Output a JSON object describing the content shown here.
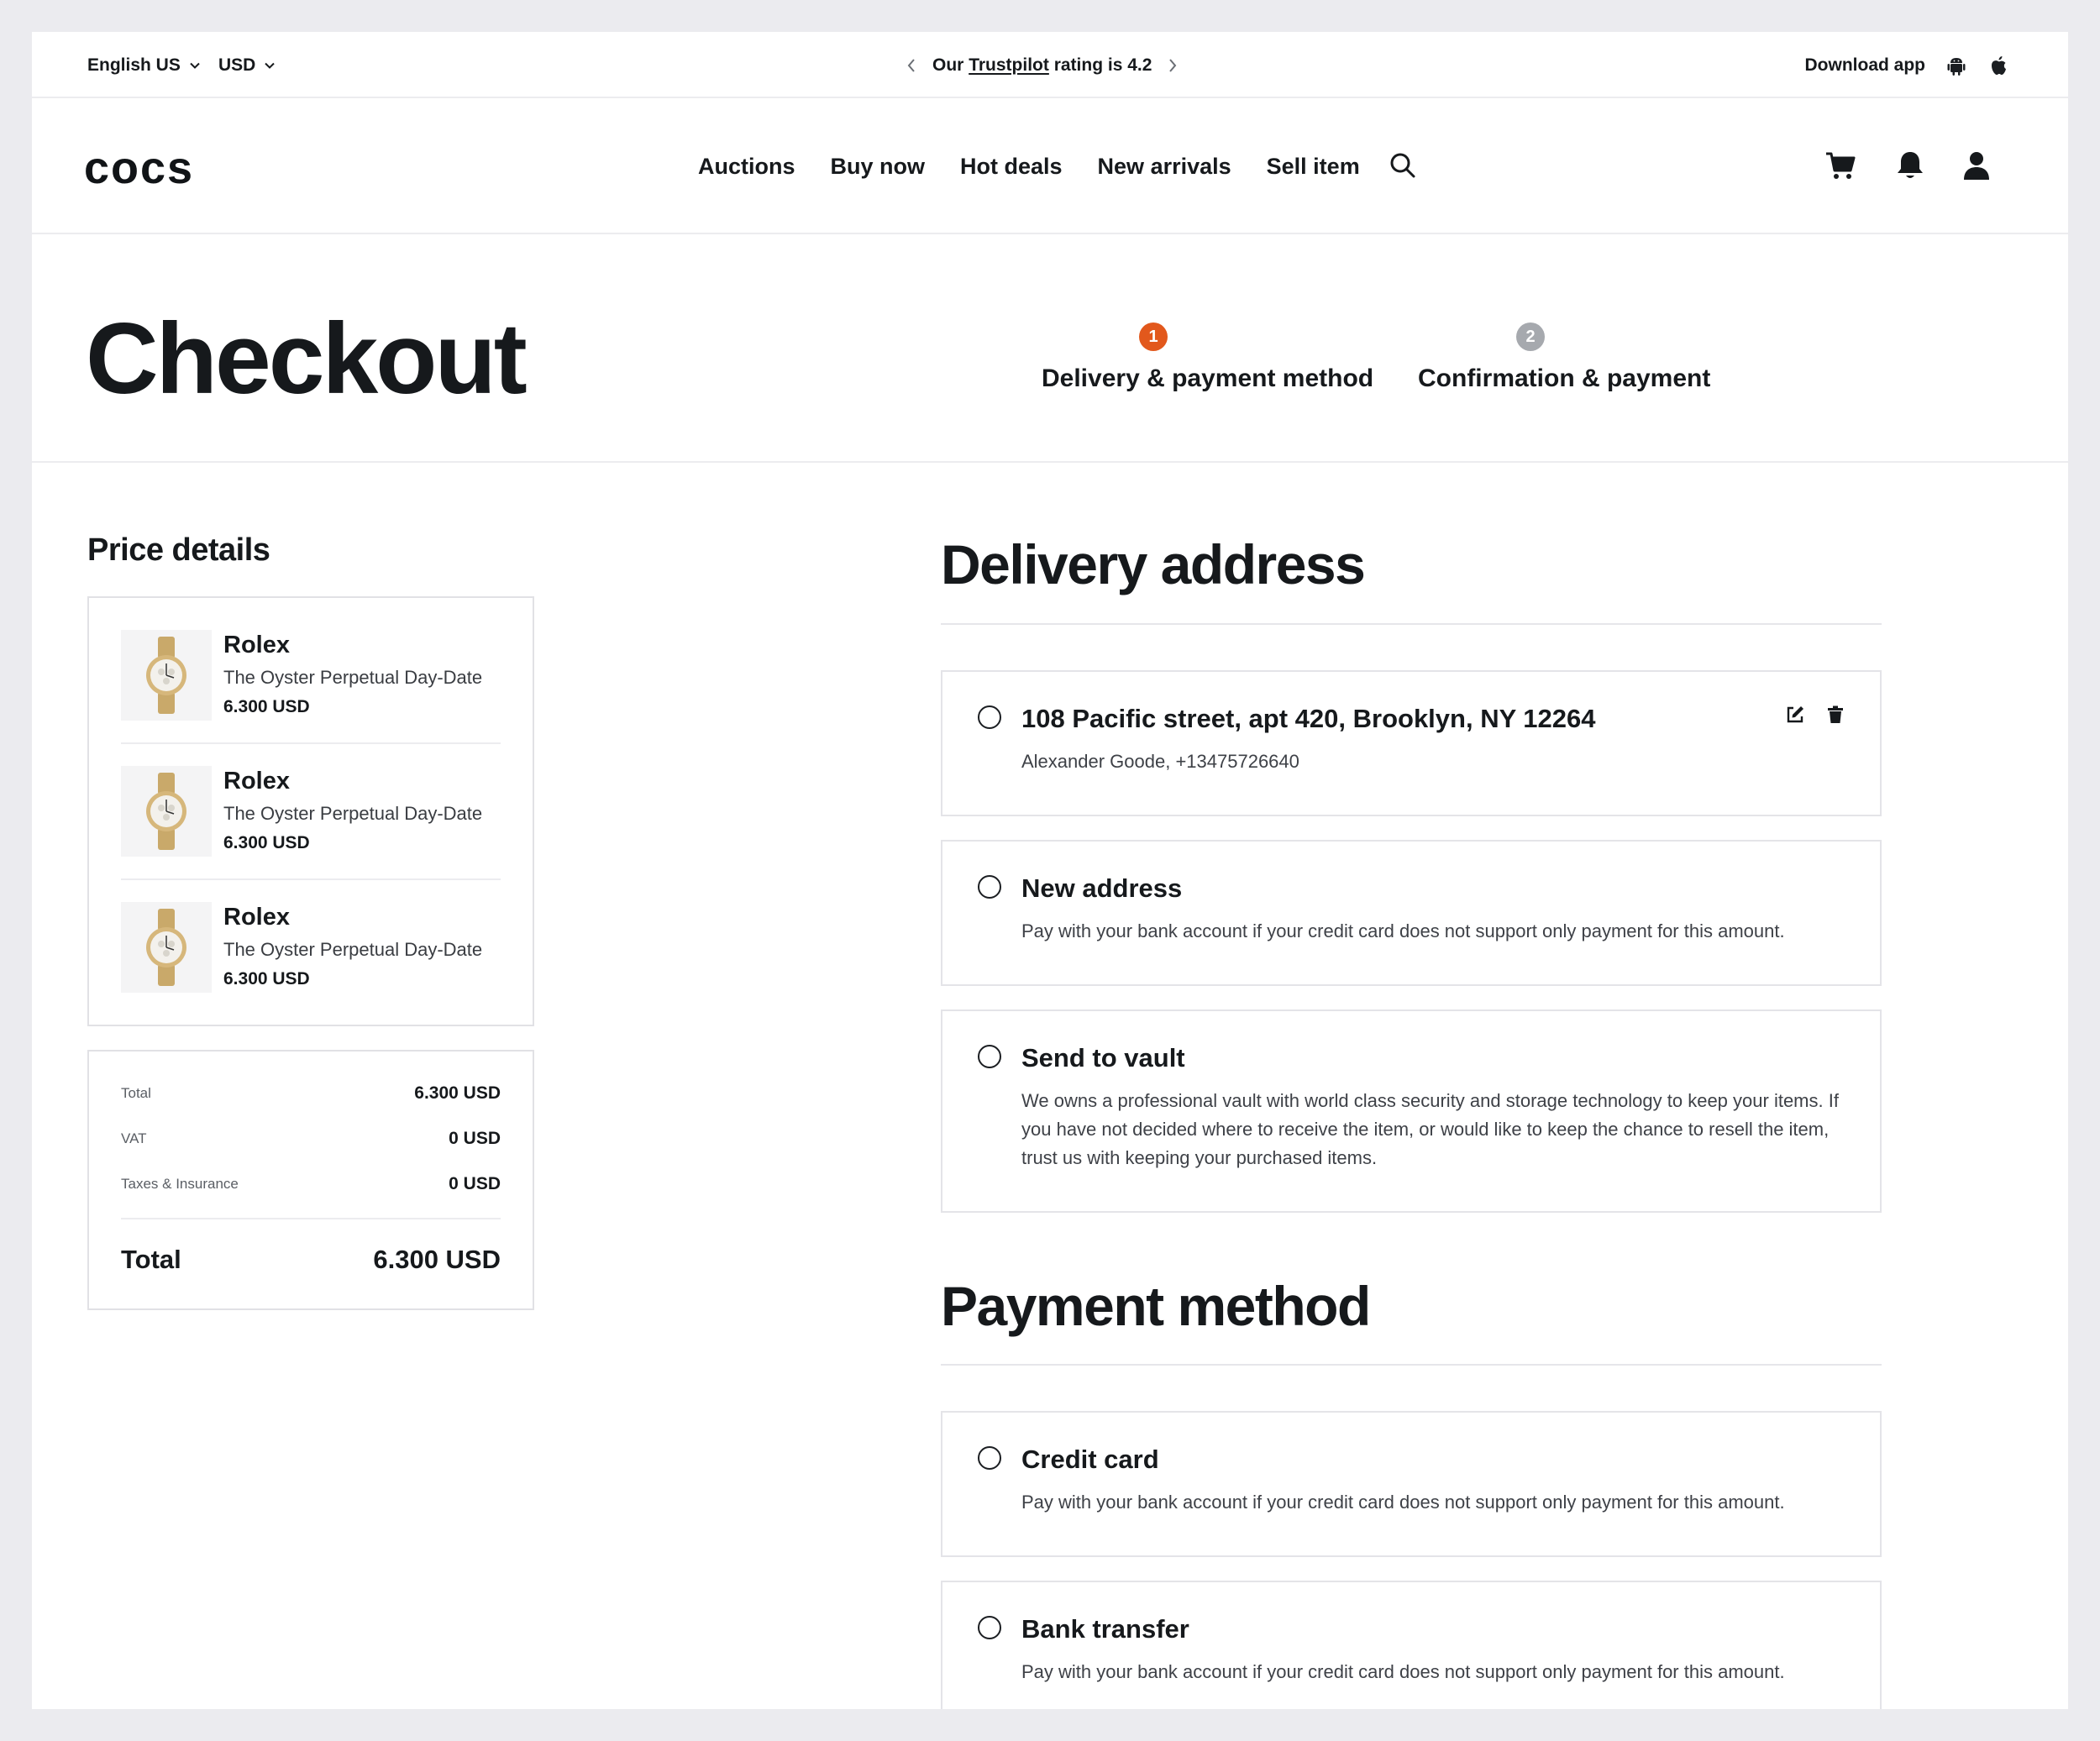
{
  "topbar": {
    "language": "English US",
    "currency": "USD",
    "trust_prefix": "Our",
    "trust_link": "Trustpilot",
    "trust_suffix": "rating is 4.2",
    "download_label": "Download app"
  },
  "nav": {
    "logo": "cocs",
    "items": [
      "Auctions",
      "Buy now",
      "Hot deals",
      "New arrivals",
      "Sell item"
    ]
  },
  "checkout": {
    "title": "Checkout",
    "steps": [
      {
        "number": "1",
        "label": "Delivery & payment method",
        "active": true,
        "color": "#e2581c"
      },
      {
        "number": "2",
        "label": "Confirmation & payment",
        "active": false,
        "color": "#a6a9ae"
      }
    ]
  },
  "price_details": {
    "title": "Price details",
    "items": [
      {
        "brand": "Rolex",
        "description": "The Oyster Perpetual Day-Date",
        "price": "6.300 USD"
      },
      {
        "brand": "Rolex",
        "description": "The Oyster Perpetual Day-Date",
        "price": "6.300 USD"
      },
      {
        "brand": "Rolex",
        "description": "The Oyster Perpetual Day-Date",
        "price": "6.300 USD"
      }
    ],
    "rows": [
      {
        "label": "Total",
        "value": "6.300 USD"
      },
      {
        "label": "VAT",
        "value": "0 USD"
      },
      {
        "label": "Taxes & Insurance",
        "value": "0 USD"
      }
    ],
    "grand_total_label": "Total",
    "grand_total_value": "6.300 USD"
  },
  "delivery": {
    "title": "Delivery address",
    "options": [
      {
        "title": "108 Pacific street, apt 420, Brooklyn, NY 12264",
        "subtitle": "Alexander Goode, +13475726640"
      },
      {
        "title": "New address",
        "subtitle": "Pay with your bank account if your credit card does not support only payment for this amount."
      },
      {
        "title": "Send to vault",
        "subtitle": "We owns a professional vault with world class security and storage technology to keep your items. If you have not decided where to receive the item, or would like to keep the chance to resell the item, trust us with keeping your purchased items."
      }
    ]
  },
  "payment": {
    "title": "Payment method",
    "options": [
      {
        "title": "Credit card",
        "subtitle": "Pay with your bank account if your credit card does not support only payment for this amount."
      },
      {
        "title": "Bank transfer",
        "subtitle": "Pay with your bank account if your credit card does not support only payment for this amount."
      }
    ]
  },
  "icons": {
    "search": "search-icon",
    "cart": "cart-icon",
    "bell": "bell-icon",
    "user": "user-icon",
    "android": "android-icon",
    "apple": "apple-icon",
    "edit": "edit-icon",
    "delete": "trash-icon"
  },
  "colors": {
    "accent": "#e2581c",
    "inactive_step": "#a6a9ae",
    "text": "#16191c"
  }
}
